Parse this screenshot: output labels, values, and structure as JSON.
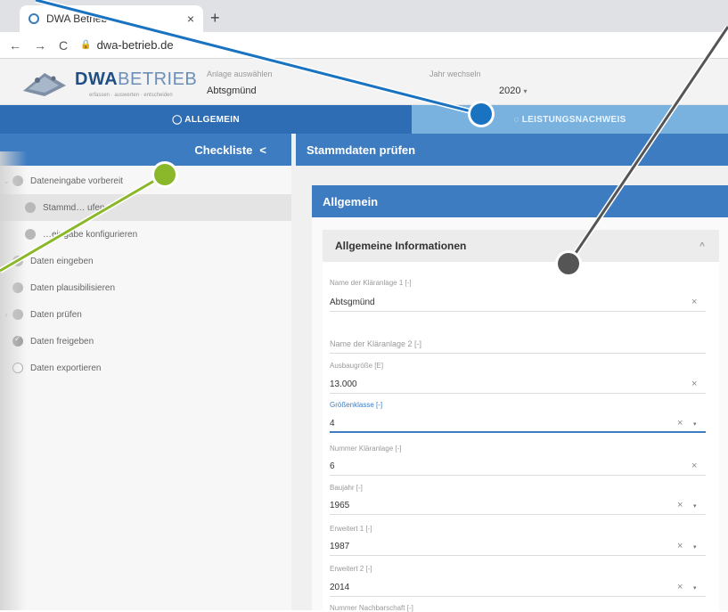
{
  "browser": {
    "tab_title": "DWA Betrieb",
    "tab_close": "×",
    "new_tab": "+",
    "url": "dwa-betrieb.de",
    "nav_back": "←",
    "nav_forward": "→",
    "nav_reload": "C",
    "lock": "🔒"
  },
  "header": {
    "logo_bold": "DWA",
    "logo_light": "BETRIEB",
    "logo_sub": "erfassen · auswerten · entscheiden",
    "anlage_label": "Anlage auswählen",
    "anlage_value": "Abtsgmünd",
    "jahr_label": "Jahr wechseln",
    "jahr_value": "2020",
    "jahr_caret": "▾"
  },
  "navtabs": [
    {
      "label": "◯ ALLGEMEIN"
    },
    {
      "label": "◌ LEISTUNGSNACHWEIS"
    }
  ],
  "subbar": {
    "checkliste": "Checkliste",
    "collapse": "<",
    "stammdaten": "Stammdaten prüfen"
  },
  "sidebar": {
    "items": [
      {
        "label": "Dateneingabe vorbereit"
      },
      {
        "label": "Stammd… ufen"
      },
      {
        "label": "…eingabe konfigurieren"
      },
      {
        "label": "Daten eingeben"
      },
      {
        "label": "Daten plausibilisieren"
      },
      {
        "label": "Daten prüfen"
      },
      {
        "label": "Daten freigeben"
      },
      {
        "label": "Daten exportieren"
      }
    ],
    "chev_down": "⌄",
    "chev_right": "›"
  },
  "main": {
    "card_title": "Allgemein",
    "section_title": "Allgemeine Informationen",
    "section_caret": "^",
    "clear": "×",
    "dropdown": "▾",
    "fields": [
      {
        "label": "Name der Kläranlage 1 [-]",
        "value": "Abtsgmünd"
      },
      {
        "label": "Name der Kläranlage 2 [-]",
        "value": ""
      },
      {
        "label": "Ausbaugröße [E]",
        "value": "13.000"
      },
      {
        "label": "Größenklasse [-]",
        "value": "4"
      },
      {
        "label": "Nummer Kläranlage [-]",
        "value": "6"
      },
      {
        "label": "Baujahr [-]",
        "value": "1965"
      },
      {
        "label": "Erweitert 1 [-]",
        "value": "1987"
      },
      {
        "label": "Erweitert 2 [-]",
        "value": "2014"
      },
      {
        "label": "Nummer Nachbarschaft [-]",
        "value": ""
      }
    ]
  },
  "colors": {
    "primary": "#2e6db3",
    "secondary": "#3e7cc2",
    "light_tab": "#79b2de",
    "callout_blue": "#1a73c0",
    "callout_green": "#8bb82a",
    "callout_gray": "#555555"
  }
}
